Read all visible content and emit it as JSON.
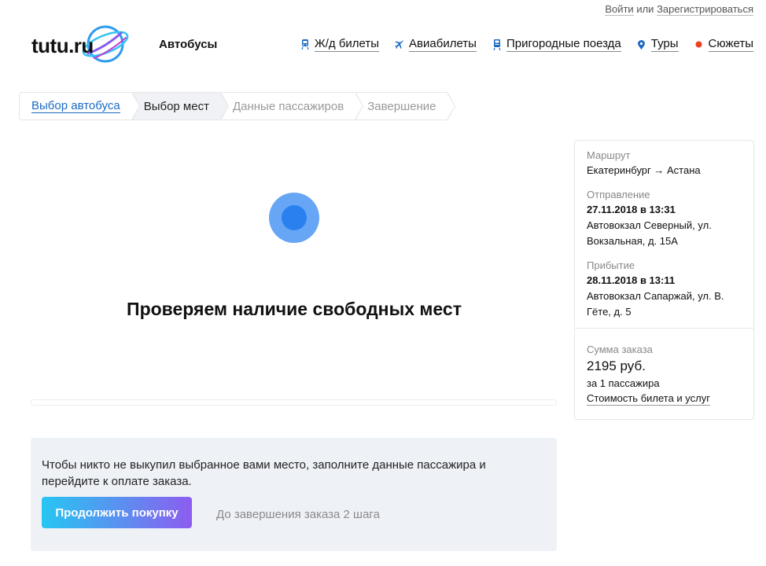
{
  "header": {
    "auth": {
      "login": "Войти",
      "or": "или",
      "register": "Зарегистрироваться"
    },
    "logo_text": "tutu.ru",
    "section": "Автобусы",
    "nav": [
      {
        "label": "Ж/д билеты",
        "icon": "train-icon"
      },
      {
        "label": "Авиабилеты",
        "icon": "plane-icon"
      },
      {
        "label": "Пригородные поезда",
        "icon": "suburban-train-icon"
      },
      {
        "label": "Туры",
        "icon": "map-pin-icon"
      },
      {
        "label": "Сюжеты",
        "icon": "red-dot-icon"
      }
    ],
    "colors": {
      "accent_link": "#1b6ac4",
      "red_dot": "#f0411f",
      "loader": "#2b80f0"
    }
  },
  "steps": [
    {
      "label": "Выбор автобуса",
      "state": "done"
    },
    {
      "label": "Выбор мест",
      "state": "current"
    },
    {
      "label": "Данные пассажиров",
      "state": "upcoming"
    },
    {
      "label": "Завершение",
      "state": "upcoming"
    }
  ],
  "main": {
    "loading_title": "Проверяем наличие свободных мест"
  },
  "continue": {
    "text": "Чтобы никто не выкупил выбранное вами место, заполните данные пассажира и перейдите к оплате заказа.",
    "button": "Продолжить покупку",
    "hint": "До завершения заказа 2 шага"
  },
  "summary": {
    "route_label": "Маршрут",
    "route_value": "Екатеринбург → Астана",
    "departure_label": "Отправление",
    "departure_datetime": "27.11.2018 в 13:31",
    "departure_place": "Автовокзал Северный, ул. Вокзальная, д. 15А",
    "arrival_label": "Прибытие",
    "arrival_datetime": "28.11.2018 в 13:11",
    "arrival_place": "Автовокзал Сапаржай, ул. В. Гёте, д. 5",
    "total_label": "Сумма заказа",
    "total_value": "2195 руб.",
    "per_passengers": "за 1 пассажира",
    "cost_link": "Стоимость билета и услуг"
  }
}
